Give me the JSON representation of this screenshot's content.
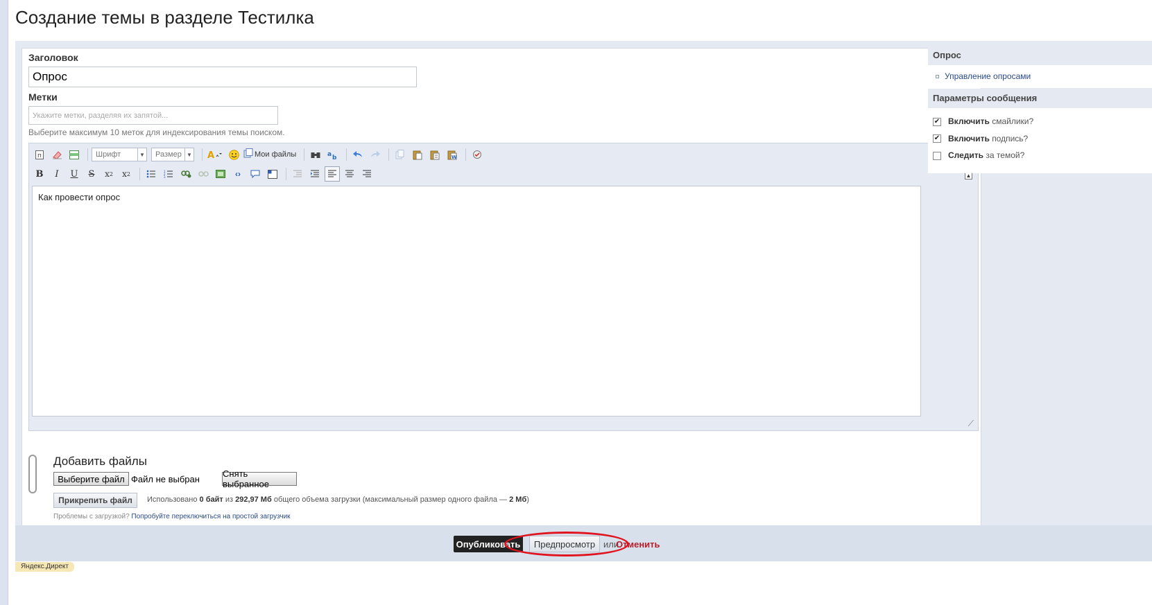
{
  "page": {
    "title": "Создание темы в разделе Тестилка"
  },
  "form": {
    "title_label": "Заголовок",
    "title_value": "Опрос",
    "tags_label": "Метки",
    "tags_placeholder": "Укажите метки, разделяя их запятой...",
    "tags_hint": "Выберите максимум 10 меток для индексирования темы поиском."
  },
  "editor": {
    "font_select": "Шрифт",
    "size_select": "Размер",
    "my_files": "Мои файлы",
    "content": "Как провести опрос",
    "toolbar_row1_icons": [
      "source-icon",
      "eraser-icon",
      "table-icon",
      "font-color-icon",
      "smiley-icon",
      "files-icon",
      "find-icon",
      "replace-icon",
      "undo-icon",
      "redo-icon",
      "copy-icon",
      "paste-icon",
      "paste-text-icon",
      "paste-word-icon",
      "spellcheck-icon"
    ],
    "toolbar_row2_icons": [
      "bold-icon",
      "italic-icon",
      "underline-icon",
      "strike-icon",
      "subscript-icon",
      "superscript-icon",
      "bullet-list-icon",
      "numbered-list-icon",
      "link-icon",
      "unlink-icon",
      "image-icon",
      "code-icon",
      "quote-icon",
      "spoiler-icon",
      "outdent-icon",
      "indent-icon",
      "align-left-icon",
      "align-center-icon",
      "align-right-icon"
    ]
  },
  "files": {
    "title": "Добавить файлы",
    "choose_btn": "Выберите файл",
    "no_file": "Файл не выбран",
    "clear_btn": "Снять выбранное",
    "attach_btn": "Прикрепить файл",
    "usage_prefix": "Использовано",
    "usage_used": "0 байт",
    "usage_of": "из",
    "usage_total": "292,97 Мб",
    "usage_suffix": "общего объема загрузки (максимальный размер одного файла —",
    "usage_max": "2 Мб",
    "usage_close": ")",
    "problems": "Проблемы с загрузкой?",
    "problems_link": "Попробуйте переключиться на простой загрузчик"
  },
  "sidebar": {
    "poll_header": "Опрос",
    "poll_link": "Управление опросами",
    "params_header": "Параметры сообщения",
    "options": [
      {
        "bold": "Включить",
        "rest": "смайлики?",
        "checked": true
      },
      {
        "bold": "Включить",
        "rest": "подпись?",
        "checked": true
      },
      {
        "bold": "Следить",
        "rest": "за темой?",
        "checked": false
      }
    ]
  },
  "footer": {
    "publish": "Опубликовать",
    "preview": "Предпросмотр",
    "or": "или",
    "cancel": "Отменить",
    "annotation_color": "#e0141e"
  },
  "ad_label": "Яндекс.Директ"
}
